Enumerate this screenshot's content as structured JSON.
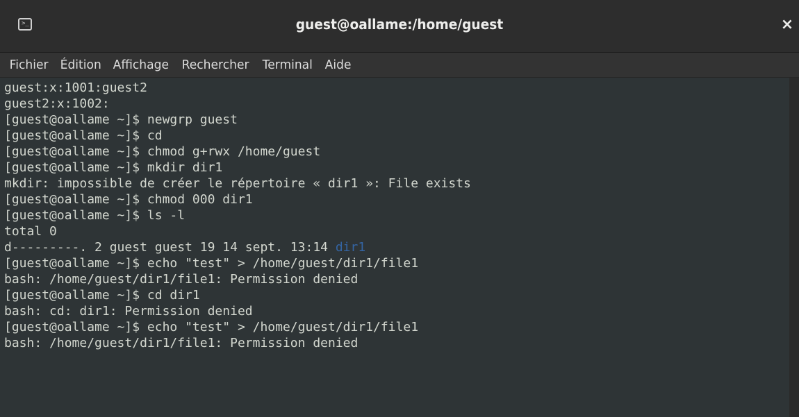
{
  "window": {
    "title": "guest@oallame:/home/guest",
    "close_glyph": "×",
    "icon": "terminal-icon",
    "icon_prompt": ">_"
  },
  "menu": [
    "Fichier",
    "Édition",
    "Affichage",
    "Rechercher",
    "Terminal",
    "Aide"
  ],
  "colors": {
    "background": "#2e3436",
    "foreground": "#d3d7cf",
    "directory": "#3465a4",
    "titlebar": "#2d2d2d",
    "menubar": "#333333"
  },
  "terminal": {
    "lines": [
      "guest:x:1001:guest2",
      "guest2:x:1002:",
      "[guest@oallame ~]$ newgrp guest",
      "[guest@oallame ~]$ cd",
      "[guest@oallame ~]$ chmod g+rwx /home/guest",
      "[guest@oallame ~]$ mkdir dir1",
      "mkdir: impossible de créer le répertoire « dir1 »: File exists",
      "[guest@oallame ~]$ chmod 000 dir1",
      "[guest@oallame ~]$ ls -l",
      "total 0",
      "d---------. 2 guest guest 19 14 sept. 13:14 ",
      "[guest@oallame ~]$ echo \"test\" > /home/guest/dir1/file1",
      "bash: /home/guest/dir1/file1: Permission denied",
      "[guest@oallame ~]$ cd dir1",
      "bash: cd: dir1: Permission denied",
      "[guest@oallame ~]$ echo \"test\" > /home/guest/dir1/file1",
      "bash: /home/guest/dir1/file1: Permission denied"
    ],
    "ls_entry_name": "dir1"
  }
}
